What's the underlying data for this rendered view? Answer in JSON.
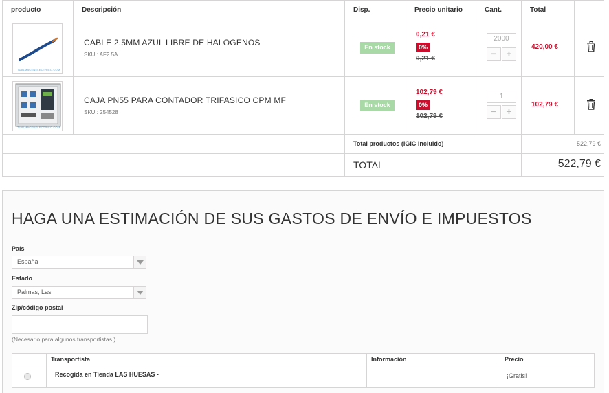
{
  "cart": {
    "headers": {
      "product": "producto",
      "description": "Descripción",
      "availability": "Disp.",
      "unit_price": "Precio unitario",
      "quantity": "Cant.",
      "total": "Total"
    },
    "items": [
      {
        "name": "CABLE 2.5MM AZUL LIBRE DE HALOGENOS",
        "sku": "SKU : AF2.5A",
        "stock": "En stock",
        "price": "0,21 €",
        "discount": "0%",
        "old_price": "0,21 €",
        "quantity": "2000",
        "total": "420,00 €",
        "thumb_caption": "TUALMACENELECTRICO.COM",
        "icon": "trash-icon"
      },
      {
        "name": "CAJA PN55 PARA CONTADOR TRIFASICO CPM MF",
        "sku": "SKU : 254528",
        "stock": "En stock",
        "price": "102,79 €",
        "discount": "0%",
        "old_price": "102,79 €",
        "quantity": "1",
        "total": "102,79 €",
        "thumb_caption": "TUALMACENELECTRICO.COM",
        "icon": "trash-icon"
      }
    ],
    "qty_minus": "−",
    "qty_plus": "+",
    "summary": {
      "products_label": "Total productos (IGIC incluido)",
      "products_value": "522,79 €",
      "total_label": "TOTAL",
      "total_value": "522,79 €"
    }
  },
  "estimate": {
    "title": "HAGA UNA ESTIMACIÓN DE SUS GASTOS DE ENVÍO E IMPUESTOS",
    "country_label": "País",
    "country_value": "España",
    "state_label": "Estado",
    "state_value": "Palmas, Las",
    "zip_label": "Zip/código postal",
    "zip_value": "",
    "zip_note": "(Necesario para algunos transportistas.)",
    "carriers": {
      "headers": {
        "carrier": "Transportista",
        "info": "Información",
        "price": "Precio"
      },
      "rows": [
        {
          "name": "Recogida en Tienda LAS HUESAS -",
          "info": "",
          "price": "¡Gratis!"
        }
      ]
    }
  },
  "colors": {
    "price_red": "#c8102e",
    "stock_green": "#a9d9a7",
    "border": "#d6d4d4"
  }
}
